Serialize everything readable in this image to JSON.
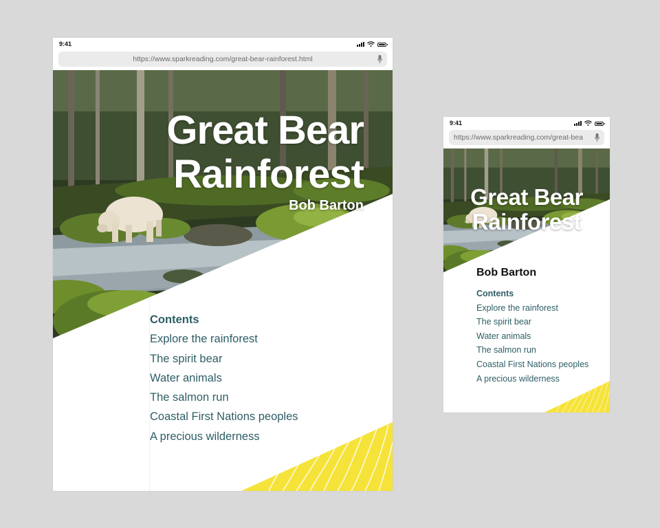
{
  "status": {
    "time": "9:41"
  },
  "browser": {
    "url": "https://www.sparkreading.com/great-bear-rainforest.html",
    "url_phone": "https://www.sparkreading.com/great-bea"
  },
  "book": {
    "title_line1": "Great Bear",
    "title_line2": "Rainforest",
    "author": "Bob Barton"
  },
  "contents": {
    "heading": "Contents",
    "items": [
      "Explore the rainforest",
      "The spirit bear",
      "Water animals",
      "The salmon run",
      "Coastal First Nations peoples",
      "A precious wilderness"
    ]
  },
  "colors": {
    "accent_yellow": "#f6e33a",
    "contents_text": "#2e5e66",
    "moss_green": "#6f8f2e"
  },
  "icons": [
    "signal-icon",
    "wifi-icon",
    "battery-icon",
    "microphone-icon"
  ]
}
